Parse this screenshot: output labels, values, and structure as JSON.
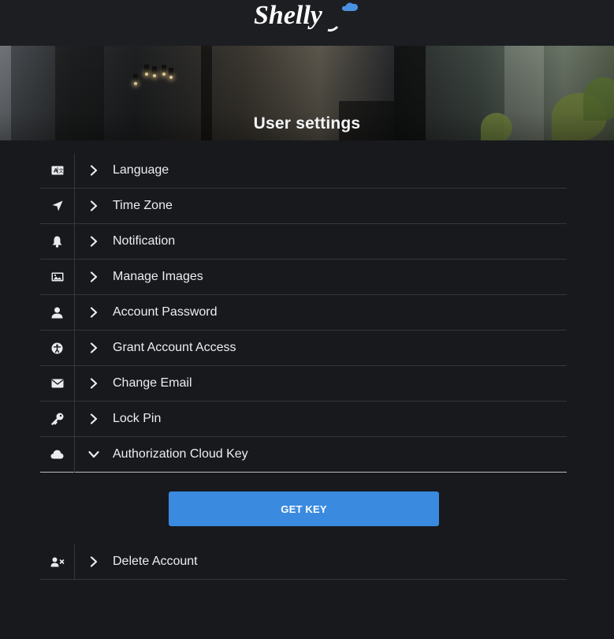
{
  "header": {
    "logo_text": "Shelly"
  },
  "page": {
    "title": "User settings"
  },
  "settings": {
    "items": [
      {
        "label": "Language",
        "icon": "language-icon"
      },
      {
        "label": "Time Zone",
        "icon": "location-arrow-icon"
      },
      {
        "label": "Notification",
        "icon": "bell-icon"
      },
      {
        "label": "Manage Images",
        "icon": "image-icon"
      },
      {
        "label": "Account Password",
        "icon": "user-icon"
      },
      {
        "label": "Grant Account Access",
        "icon": "accessibility-icon"
      },
      {
        "label": "Change Email",
        "icon": "envelope-icon"
      },
      {
        "label": "Lock Pin",
        "icon": "key-icon"
      },
      {
        "label": "Authorization Cloud Key",
        "icon": "cloud-icon",
        "expanded": true
      }
    ],
    "get_key_label": "GET KEY",
    "delete_account": {
      "label": "Delete Account",
      "icon": "user-remove-icon"
    }
  },
  "colors": {
    "background": "#18191d",
    "accent": "#3a8ae0",
    "divider": "#34363b"
  }
}
